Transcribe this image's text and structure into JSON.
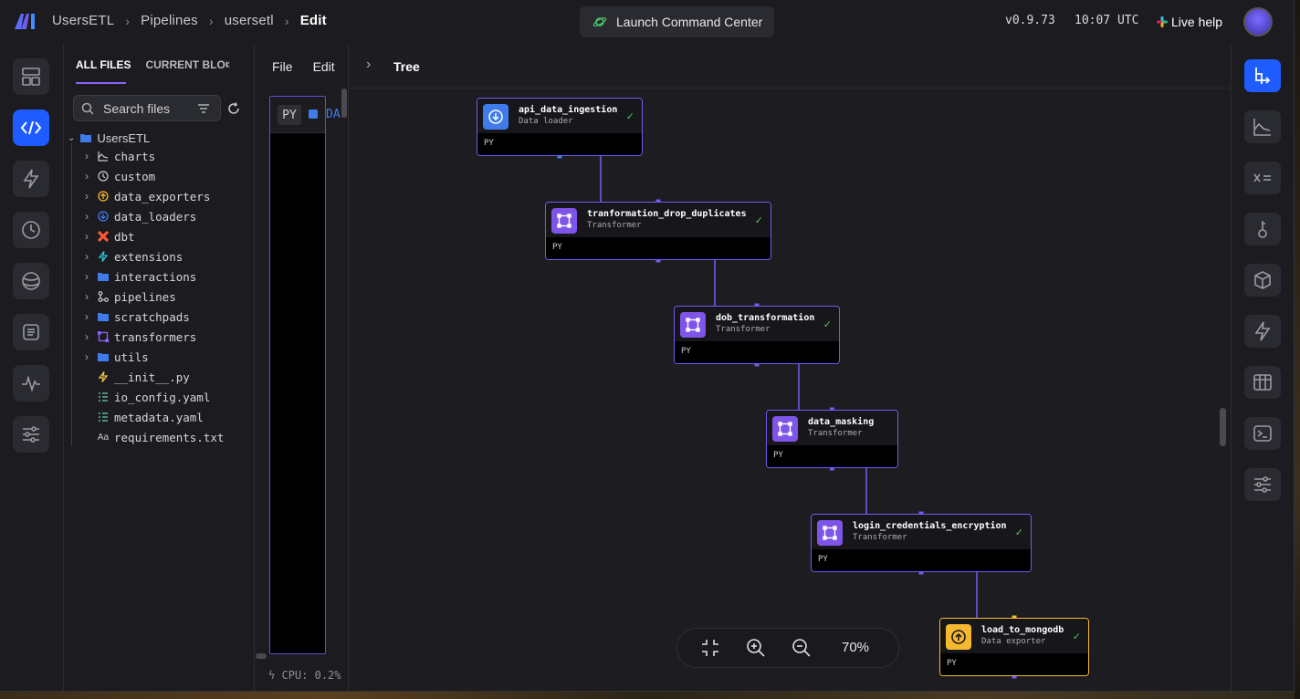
{
  "header": {
    "breadcrumbs": [
      "UsersETL",
      "Pipelines",
      "usersetl",
      "Edit"
    ],
    "launch_label": "Launch Command Center",
    "version": "v0.9.73",
    "time": "10:07 UTC",
    "live_help": "Live help"
  },
  "files_panel": {
    "tab_all": "ALL FILES",
    "tab_current": "CURRENT BLOCK",
    "search_placeholder": "Search files",
    "root": "UsersETL",
    "items": [
      {
        "label": "charts",
        "icon": "chart-icon"
      },
      {
        "label": "custom",
        "icon": "custom-icon"
      },
      {
        "label": "data_exporters",
        "icon": "upload-icon"
      },
      {
        "label": "data_loaders",
        "icon": "download-icon"
      },
      {
        "label": "dbt",
        "icon": "dbt-icon"
      },
      {
        "label": "extensions",
        "icon": "extension-icon"
      },
      {
        "label": "interactions",
        "icon": "folder-icon"
      },
      {
        "label": "pipelines",
        "icon": "pipeline-icon"
      },
      {
        "label": "scratchpads",
        "icon": "folder-icon"
      },
      {
        "label": "transformers",
        "icon": "transformer-icon"
      },
      {
        "label": "utils",
        "icon": "folder-icon"
      },
      {
        "label": "__init__.py",
        "icon": "python-icon"
      },
      {
        "label": "io_config.yaml",
        "icon": "yaml-icon"
      },
      {
        "label": "metadata.yaml",
        "icon": "yaml-icon"
      },
      {
        "label": "requirements.txt",
        "icon": "text-icon"
      }
    ]
  },
  "editor": {
    "menu_file": "File",
    "menu_edit": "Edit",
    "block_lang": "PY",
    "block_name_fragment": "DA",
    "cpu": "CPU: 0.2%"
  },
  "canvas": {
    "title": "Tree",
    "zoom": "70%",
    "nodes": [
      {
        "name": "api_data_ingestion",
        "type": "Data loader",
        "lang": "PY",
        "status": "✓"
      },
      {
        "name": "tranformation_drop_duplicates",
        "type": "Transformer",
        "lang": "PY",
        "status": "✓"
      },
      {
        "name": "dob_transformation",
        "type": "Transformer",
        "lang": "PY",
        "status": "✓"
      },
      {
        "name": "data_masking",
        "type": "Transformer",
        "lang": "PY",
        "status": ""
      },
      {
        "name": "login_credentials_encryption",
        "type": "Transformer",
        "lang": "PY",
        "status": "✓"
      },
      {
        "name": "load_to_mongodb",
        "type": "Data exporter",
        "lang": "PY",
        "status": "✓"
      }
    ]
  },
  "colors": {
    "accent": "#1f5cff",
    "transformer": "#7e55e6",
    "loader": "#3f7bea",
    "exporter": "#f5b82e",
    "success": "#4ec46d"
  }
}
